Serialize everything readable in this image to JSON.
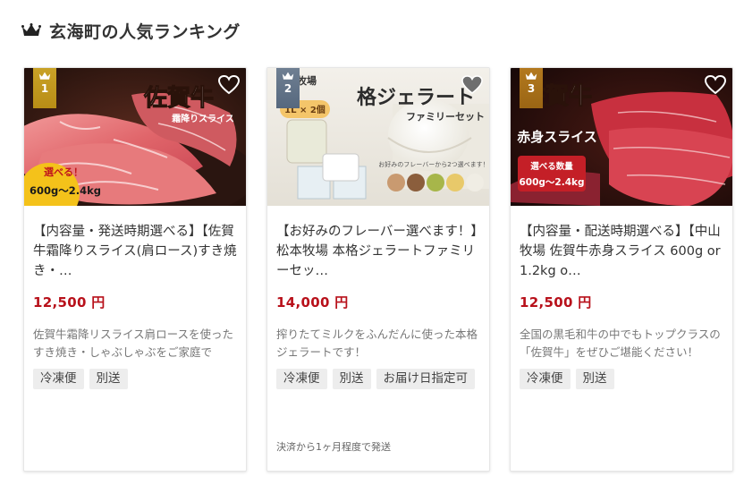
{
  "section": {
    "title": "玄海町の人気ランキング",
    "icon": "crown-icon"
  },
  "items": [
    {
      "rank": "1",
      "image_text": {
        "main": "佐賀牛",
        "sub": "霜降りスライス",
        "badge_top": "選べる！",
        "badge_bottom": "600g～2.4kg"
      },
      "title": "【内容量・発送時期選べる】【佐賀牛霜降りスライス(肩ロース)すき焼き・…",
      "price": "12,500 円",
      "description": "佐賀牛霜降リスライス肩ロースを使ったすき焼き・しゃぶしゃぶをご家庭で",
      "tags": [
        "冷凍便",
        "別送"
      ],
      "shipping_note": ""
    },
    {
      "rank": "2",
      "image_text": {
        "top": "牧場",
        "main": "格ジェラート",
        "sub": "ファミリーセット",
        "size_tag": "1L × 2個",
        "bottom": "お好みのフレーバーから2つ選べます！"
      },
      "title": "【お好みのフレーバー選べます！】松本牧場 本格ジェラートファミリーセッ…",
      "price": "14,000 円",
      "description": "搾りたてミルクをふんだんに使った本格ジェラートです！",
      "tags": [
        "冷凍便",
        "別送",
        "お届け日指定可"
      ],
      "shipping_note": "決済から1ヶ月程度で発送"
    },
    {
      "rank": "3",
      "image_text": {
        "main": "佐賀牛",
        "sub": "赤身スライス",
        "badge_top": "選べる数量",
        "badge_bottom": "600g～2.4kg"
      },
      "title": "【内容量・配送時期選べる】【中山牧場 佐賀牛赤身スライス 600g or 1.2kg o…",
      "price": "12,500 円",
      "description": "全国の黒毛和牛の中でもトップクラスの「佐賀牛」をぜひご堪能ください！",
      "tags": [
        "冷凍便",
        "別送"
      ],
      "shipping_note": ""
    }
  ],
  "colors": {
    "price": "#b8111b",
    "rank_gold": "#c9a227",
    "rank_silver": "#6f7f92",
    "rank_bronze": "#b3791e"
  }
}
